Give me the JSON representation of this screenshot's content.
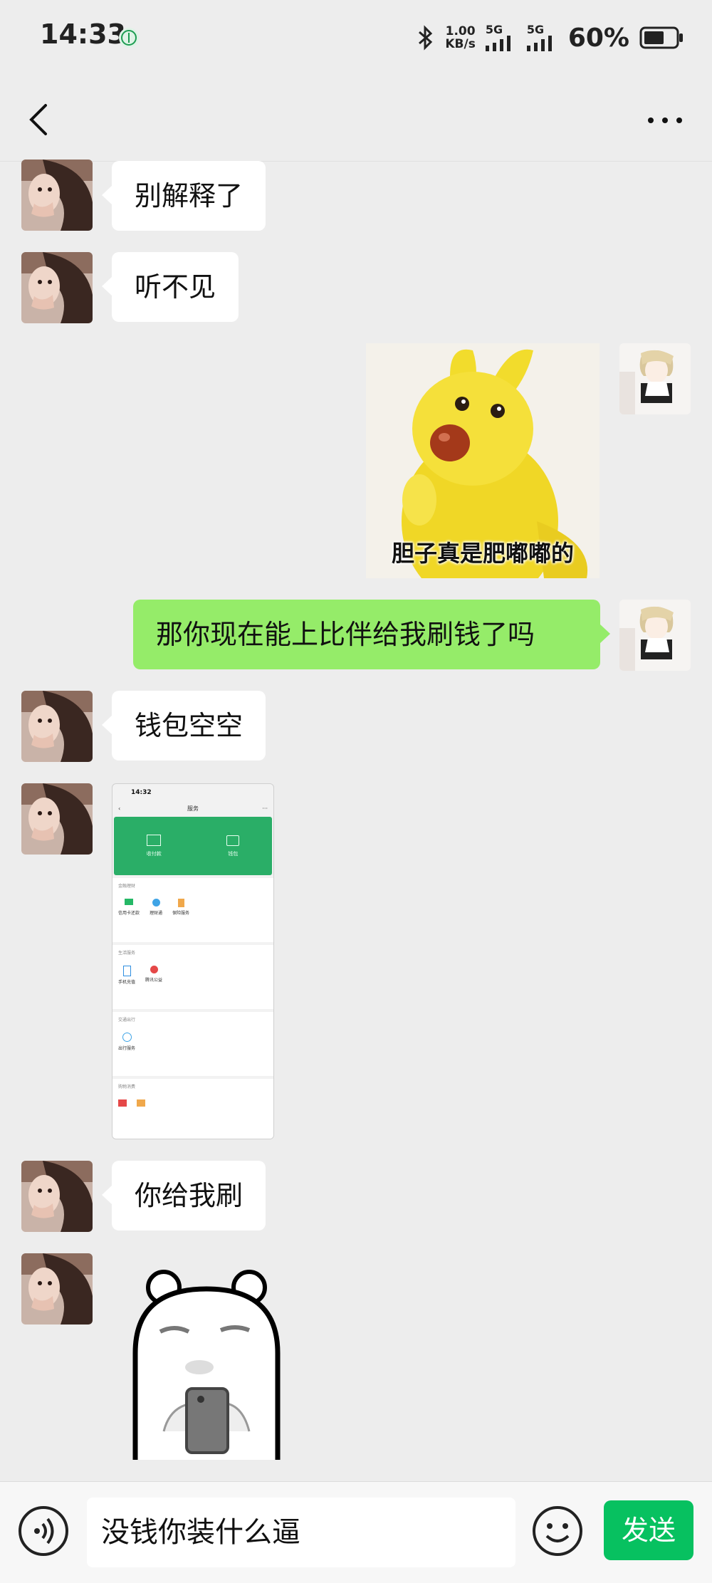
{
  "status_bar": {
    "time": "14:33",
    "net_speed_value": "1.00",
    "net_speed_unit": "KB/s",
    "sim1": "5G",
    "sim2": "5G",
    "battery": "60%"
  },
  "messages": [
    {
      "side": "left",
      "type": "text",
      "text": "别解释了"
    },
    {
      "side": "left",
      "type": "text",
      "text": "听不见"
    },
    {
      "side": "right",
      "type": "sticker",
      "caption": "胆子真是肥嘟嘟的"
    },
    {
      "side": "right",
      "type": "text",
      "text": "那你现在能上比伴给我刷钱了吗"
    },
    {
      "side": "left",
      "type": "text",
      "text": "钱包空空"
    },
    {
      "side": "left",
      "type": "image"
    },
    {
      "side": "left",
      "type": "text",
      "text": "你给我刷"
    },
    {
      "side": "left",
      "type": "sticker"
    }
  ],
  "screenshot_thumb": {
    "time": "14:32",
    "title": "服务",
    "header": [
      {
        "label": "收付款"
      },
      {
        "label": "钱包"
      }
    ],
    "sections": [
      {
        "title": "金融理财",
        "items": [
          "信用卡还款",
          "理财通",
          "保险服务"
        ]
      },
      {
        "title": "生活服务",
        "items": [
          "手机充值",
          "腾讯公益"
        ]
      },
      {
        "title": "交通出行",
        "items": [
          "出行服务"
        ]
      },
      {
        "title": "购物消费",
        "items": []
      }
    ]
  },
  "composer": {
    "input_text": "没钱你装什么逼",
    "send_label": "发送"
  }
}
